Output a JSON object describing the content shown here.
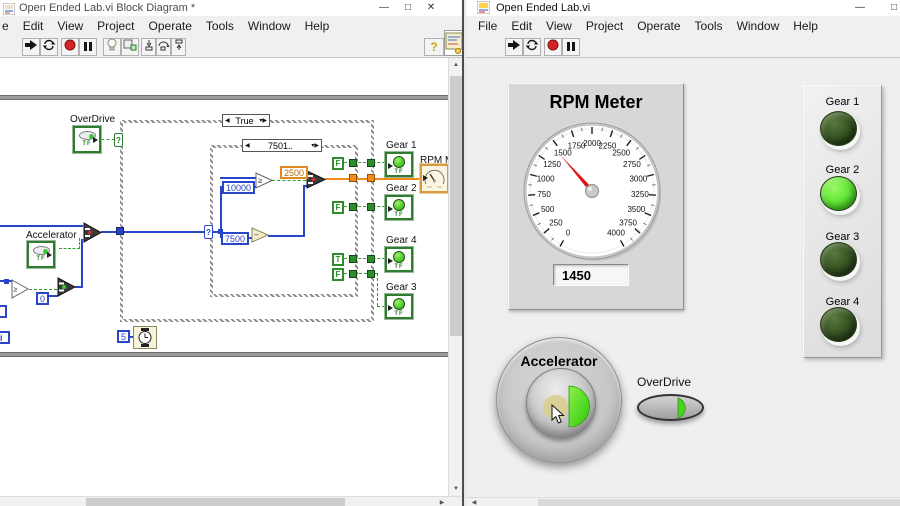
{
  "left_window": {
    "title": "Open Ended Lab.vi Block Diagram *",
    "window_controls": {
      "minimize": "—",
      "maximize": "□",
      "close": "✕"
    },
    "menu": [
      "e",
      "Edit",
      "View",
      "Project",
      "Operate",
      "Tools",
      "Window",
      "Help"
    ],
    "toolbar_icons": [
      "run",
      "run-continuously",
      "abort",
      "pause",
      "highlight-execution",
      "retain-wire-values",
      "step-into",
      "step-over",
      "step-out",
      "context-help"
    ],
    "help_button": "?",
    "diagram": {
      "case_true_label": "True",
      "case_range_label": "7501..",
      "selector_glyph": "?",
      "overdrive_label": "OverDrive",
      "accelerator_label": "Accelerator",
      "tf": "TF",
      "constants": {
        "k10000": "10000",
        "k7500": "7500",
        "k2500": "2500",
        "k0": "0",
        "k5": "5",
        "iter": "i"
      },
      "compare_glyph": "≥",
      "subtract_glyph": "−",
      "bools": [
        "F",
        "F",
        "T",
        "F"
      ],
      "gear_terminals": [
        {
          "label": "Gear 1"
        },
        {
          "label": "Gear 2"
        },
        {
          "label": "Gear 4"
        },
        {
          "label": "Gear 3"
        }
      ],
      "rpm_terminal_label": "RPM Me"
    }
  },
  "right_window": {
    "title": "Open Ended Lab.vi",
    "window_controls": {
      "minimize": "—",
      "maximize": "□"
    },
    "menu": [
      "File",
      "Edit",
      "View",
      "Project",
      "Operate",
      "Tools",
      "Window",
      "Help"
    ],
    "toolbar_icons": [
      "run",
      "run-continuously",
      "abort",
      "pause"
    ],
    "rpm_panel": {
      "title": "RPM Meter",
      "display_value": "1450"
    },
    "gauge": {
      "min": 0,
      "max": 4000,
      "tick_step": 250,
      "minor_step": 125,
      "sweep_deg": 300,
      "value": 1450,
      "tick_labels": [
        "0",
        "250",
        "500",
        "750",
        "1000",
        "1250",
        "1500",
        "1750",
        "2000",
        "2250",
        "2500",
        "2750",
        "3000",
        "3250",
        "3500",
        "3750",
        "4000"
      ],
      "needle_color": "#e01414"
    },
    "gear_panel": {
      "on_color": "#58e23a",
      "off_color": "#2c4516",
      "leds": [
        {
          "label": "Gear 1",
          "on": false
        },
        {
          "label": "Gear 2",
          "on": true
        },
        {
          "label": "Gear 3",
          "on": false
        },
        {
          "label": "Gear 4",
          "on": false
        }
      ]
    },
    "accelerator": {
      "label": "Accelerator"
    },
    "overdrive": {
      "label": "OverDrive"
    }
  }
}
